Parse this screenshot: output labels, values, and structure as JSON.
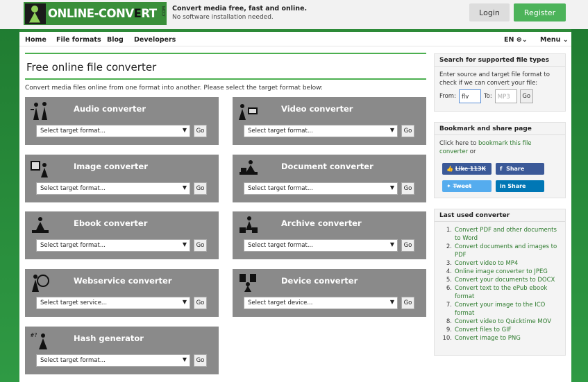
{
  "header": {
    "logo_text_a": "ONLINE-",
    "logo_text_b": "CONV",
    "logo_text_c": "E",
    "logo_text_d": "RT",
    "logo_dotcom": ".COM",
    "tagline_main": "Convert media free, fast and online.",
    "tagline_sub": "No software installation needed.",
    "login_label": "Login",
    "register_label": "Register"
  },
  "nav": {
    "items": [
      "Home",
      "File formats",
      "Blog",
      "Developers"
    ],
    "lang_label": "EN",
    "menu_label": "Menu"
  },
  "main": {
    "title": "Free online file converter",
    "intro": "Convert media files online from one format into another. Please select the target format below:",
    "go_label": "Go",
    "cards": [
      {
        "title": "Audio converter",
        "select": "Select target format...",
        "icon": "audio-icon"
      },
      {
        "title": "Video converter",
        "select": "Select target format...",
        "icon": "video-icon"
      },
      {
        "title": "Image converter",
        "select": "Select target format...",
        "icon": "image-icon"
      },
      {
        "title": "Document converter",
        "select": "Select target format...",
        "icon": "document-icon"
      },
      {
        "title": "Ebook converter",
        "select": "Select target format...",
        "icon": "ebook-icon"
      },
      {
        "title": "Archive converter",
        "select": "Select target format...",
        "icon": "archive-icon"
      },
      {
        "title": "Webservice converter",
        "select": "Select target service...",
        "icon": "webservice-icon"
      },
      {
        "title": "Device converter",
        "select": "Select target device...",
        "icon": "device-icon"
      },
      {
        "title": "Hash generator",
        "select": "Select target format...",
        "icon": "hash-icon"
      }
    ]
  },
  "search_panel": {
    "title": "Search for supported file types",
    "text": "Enter source and target file format to check if we can convert your file:",
    "from_label": "From:",
    "from_value": "flv",
    "to_label": "To:",
    "to_placeholder": "MP3",
    "go_label": "Go"
  },
  "bookmark_panel": {
    "title": "Bookmark and share page",
    "text_a": "Click here to ",
    "link": "bookmark this file converter",
    "text_b": " or",
    "like_label": "Like 113K",
    "share_fb_label": "Share",
    "tweet_label": "Tweet",
    "share_in_label": "Share"
  },
  "last_panel": {
    "title": "Last used converter",
    "items": [
      "Convert PDF and other documents to Word",
      "Convert documents and images to PDF",
      "Convert video to MP4",
      "Online image converter to JPEG",
      "Convert your documents to DOCX",
      "Convert text to the ePub ebook format",
      "Convert your image to the ICO format",
      "Convert video to Quicktime MOV",
      "Convert files to GIF",
      "Convert image to PNG"
    ]
  },
  "colors": {
    "brand_green": "#2d8a38",
    "card_gray": "#8a8a8a",
    "facebook": "#3b5998",
    "twitter": "#55acee",
    "linkedin": "#0077b5"
  }
}
